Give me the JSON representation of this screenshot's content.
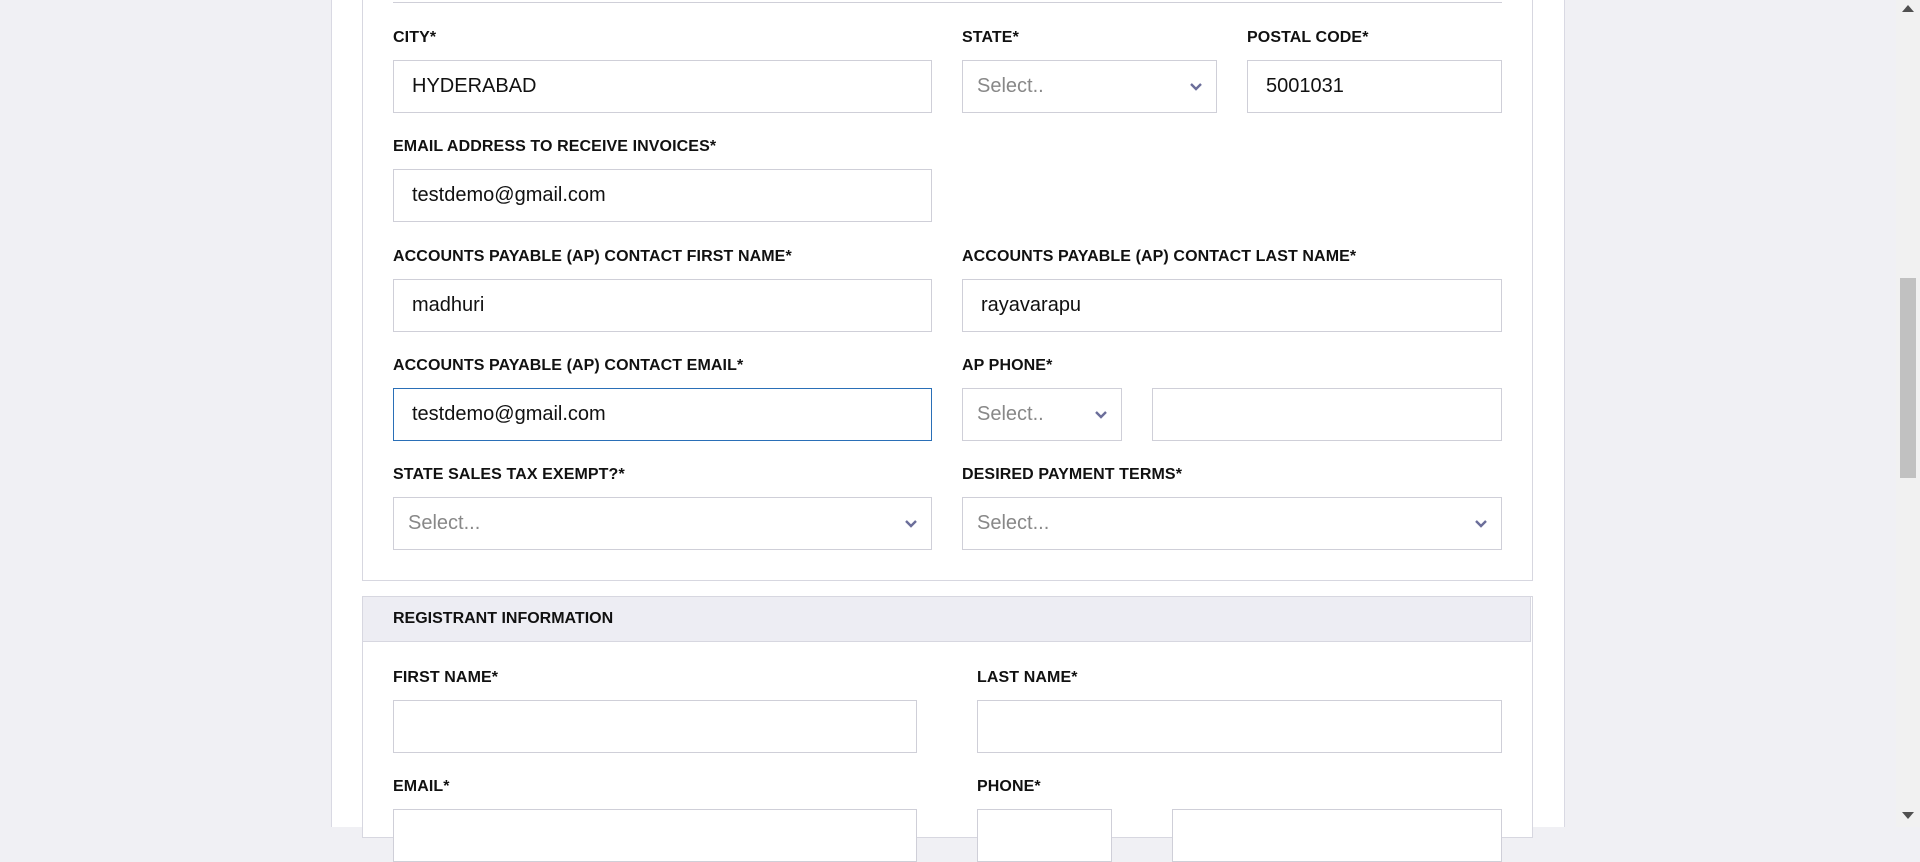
{
  "form": {
    "city": {
      "label": "CITY",
      "req": "*",
      "value": "HYDERABAD"
    },
    "state": {
      "label": "STATE",
      "req": "*",
      "placeholder": "Select.."
    },
    "postal": {
      "label": "POSTAL CODE",
      "req": "*",
      "value": "5001031"
    },
    "invoice_email": {
      "label": "EMAIL ADDRESS TO RECEIVE INVOICES",
      "req": "*",
      "value": "testdemo@gmail.com"
    },
    "ap_first": {
      "label": "ACCOUNTS PAYABLE (AP) CONTACT FIRST NAME",
      "req": "*",
      "value": "madhuri"
    },
    "ap_last": {
      "label": "ACCOUNTS PAYABLE (AP) CONTACT LAST NAME",
      "req": "*",
      "value": "rayavarapu"
    },
    "ap_email": {
      "label": "ACCOUNTS PAYABLE (AP) CONTACT EMAIL",
      "req": "*",
      "value": "testdemo@gmail.com"
    },
    "ap_phone": {
      "label": "AP PHONE",
      "req": "*",
      "code_placeholder": "Select..",
      "number_value": ""
    },
    "tax_exempt": {
      "label": "STATE SALES TAX EXEMPT?",
      "req": "*",
      "placeholder": "Select..."
    },
    "payment_terms": {
      "label": "DESIRED PAYMENT TERMS",
      "req": "*",
      "placeholder": "Select..."
    }
  },
  "registrant": {
    "title": "REGISTRANT INFORMATION",
    "first_name": {
      "label": "FIRST NAME",
      "req": "*",
      "value": ""
    },
    "last_name": {
      "label": "LAST NAME",
      "req": "*",
      "value": ""
    },
    "email": {
      "label": "EMAIL",
      "req": "*",
      "value": ""
    },
    "phone": {
      "label": "PHONE",
      "req": "*",
      "value": ""
    }
  },
  "colors": {
    "focus_border": "#2a6fb7",
    "section_bg": "#ededf3",
    "chevron": "#6b6e9a"
  }
}
